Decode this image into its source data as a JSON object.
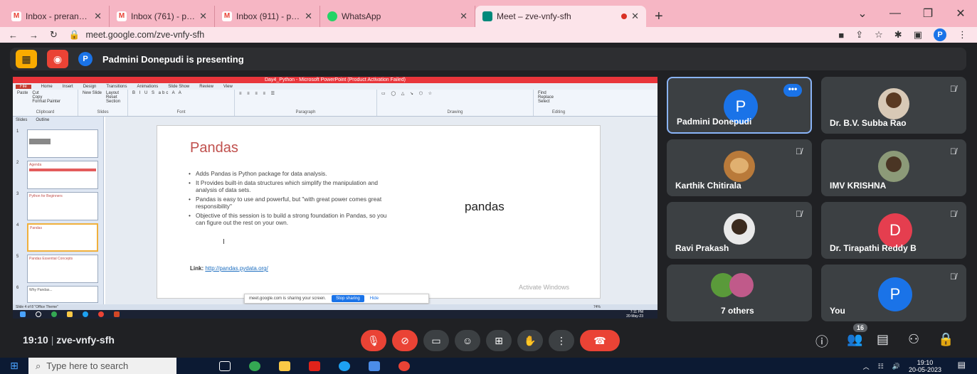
{
  "browser": {
    "tabs": [
      {
        "title": "Inbox - prerana@pvpsit.in - P",
        "icon": "gmail-icon",
        "color": "#e94235"
      },
      {
        "title": "Inbox (761) - pavankalluri@p",
        "icon": "gmail-icon",
        "color": "#e94235"
      },
      {
        "title": "Inbox (911) - pavanpvpsit@g",
        "icon": "gmail-icon",
        "color": "#e94235"
      },
      {
        "title": "WhatsApp",
        "icon": "whatsapp-icon",
        "color": "#25d366"
      },
      {
        "title": "Meet – zve-vnfy-sfh",
        "icon": "meet-icon",
        "color": "#00897b"
      }
    ],
    "new_tab": "+",
    "url": "meet.google.com/zve-vnfy-sfh",
    "profile": "P"
  },
  "presenting_bar": {
    "presenter_initial": "P",
    "text": "Padmini Donepudi is presenting"
  },
  "ppt": {
    "window_title": "Day4_Python - Microsoft PowerPoint (Product Activation Failed)",
    "menu": [
      "File",
      "Home",
      "Insert",
      "Design",
      "Transitions",
      "Animations",
      "Slide Show",
      "Review",
      "View"
    ],
    "groups": [
      "Clipboard",
      "Slides",
      "Font",
      "Paragraph",
      "Drawing",
      "Editing"
    ],
    "clipboard": [
      "Cut",
      "Copy",
      "Format Painter",
      "Paste"
    ],
    "slides_grp": [
      "Layout",
      "Reset",
      "Section",
      "New Slide"
    ],
    "editing": [
      "Find",
      "Replace",
      "Select"
    ],
    "pane_tabs": [
      "Slides",
      "Outline"
    ],
    "thumbs": [
      "",
      "Agenda",
      "Python for Beginners",
      "Pandas",
      "Pandas Essential Concepts",
      "Why Pandas..."
    ],
    "thumb_numbers": [
      "1",
      "2",
      "3",
      "4",
      "5",
      "6"
    ],
    "slide_title": "Pandas",
    "bullets": [
      "Adds Pandas is Python package for data analysis.",
      "It Provides built-in data structures which simplify the manipulation and analysis of data sets.",
      "Pandas is easy to use and powerful, but \"with great power comes great responsibility\"",
      "Objective of this session is to build a strong foundation in Pandas, so you can figure out the rest on your own."
    ],
    "logo_text": "pandas",
    "link_label": "Link:",
    "link_url": "http://pandas.pydata.org/",
    "activate": "Activate Windows",
    "status": "Slide 4 of 8   \"Office Theme\"",
    "sharing_text": "meet.google.com is sharing your screen.",
    "stop_sharing": "Stop sharing",
    "hide": "Hide",
    "inner_time": "7:11 PM",
    "inner_date": "20-May-23",
    "zoom": "74%"
  },
  "participants": [
    {
      "name": "Padmini Donepudi",
      "initial": "P",
      "color": "#1a73e8"
    },
    {
      "name": "Dr. B.V. Subba Rao"
    },
    {
      "name": "Karthik Chitirala"
    },
    {
      "name": "IMV KRISHNA"
    },
    {
      "name": "Ravi Prakash"
    },
    {
      "name": "Dr. Tirapathi Reddy B",
      "initial": "D",
      "color": "#e53e4f"
    },
    {
      "name": "7 others"
    },
    {
      "name": "You",
      "initial": "P",
      "color": "#1a73e8"
    }
  ],
  "tile_menu": "•••",
  "bottom": {
    "time": "19:10",
    "code": "zve-vnfy-sfh",
    "separator": "|",
    "participant_count": "16"
  },
  "taskbar": {
    "search_placeholder": "Type here to search",
    "time": "19:10",
    "date": "20-05-2023"
  }
}
